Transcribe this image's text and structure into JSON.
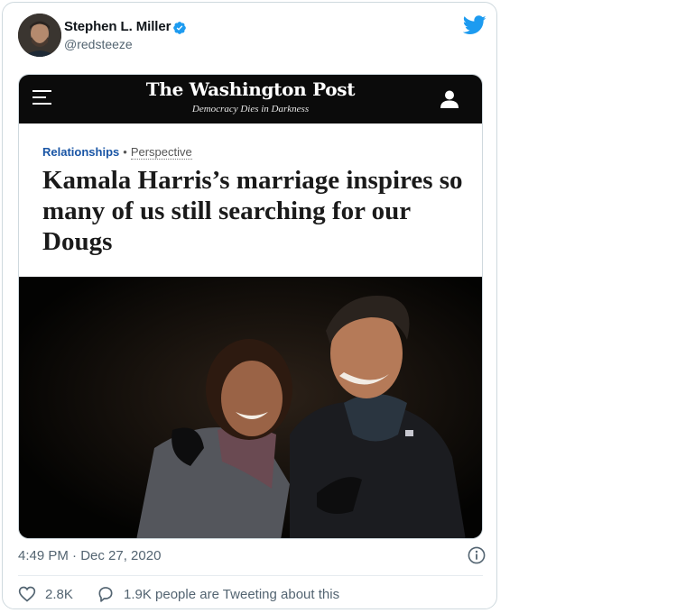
{
  "tweet": {
    "author_name": "Stephen L. Miller",
    "handle": "@redsteeze",
    "timestamp": "4:49 PM · Dec 27, 2020",
    "likes": "2.8K",
    "retweet_text": "1.9K people are Tweeting about this"
  },
  "article": {
    "masthead": "The Washington Post",
    "tagline": "Democracy Dies in Darkness",
    "section": "Relationships",
    "separator": "•",
    "type": "Perspective",
    "headline": "Kamala Harris’s marriage inspires so many of us still searching for our Dougs"
  },
  "colors": {
    "accent": "#1d9bf0",
    "section_blue": "#1955a5",
    "muted": "#536471"
  },
  "icons": {
    "verified": "verified-badge-icon",
    "logo": "twitter-bird-icon",
    "menu": "hamburger-menu-icon",
    "account": "user-icon",
    "info": "info-icon",
    "like": "heart-icon",
    "reply": "speech-bubble-icon"
  }
}
